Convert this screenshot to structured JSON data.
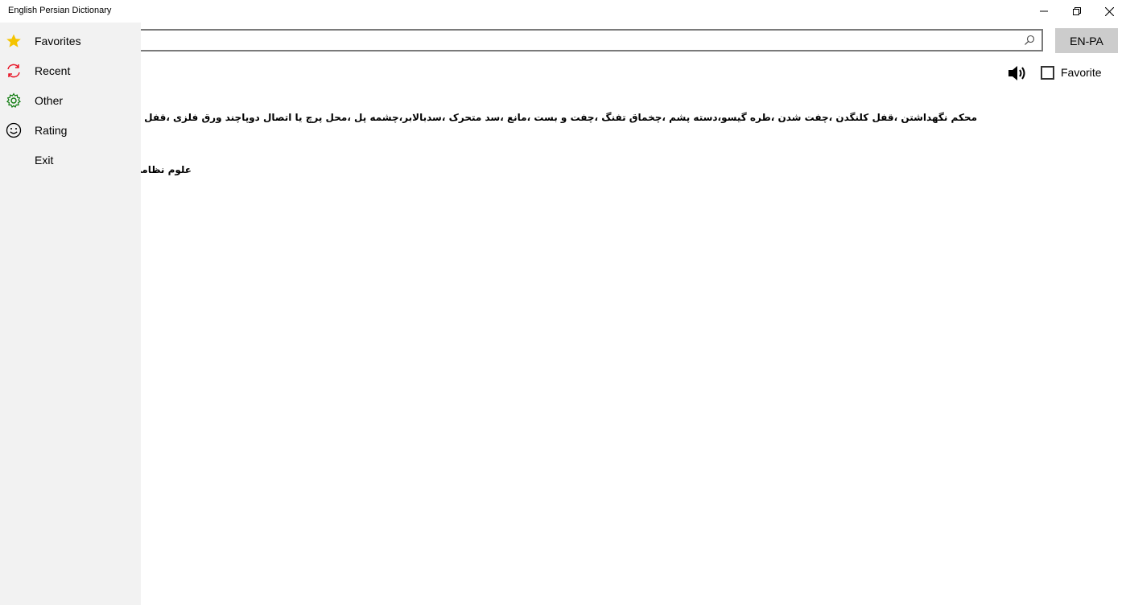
{
  "app": {
    "title": "English Persian Dictionary"
  },
  "window_controls": {
    "minimize": "minimize-icon",
    "maximize": "restore-icon",
    "close": "close-icon"
  },
  "search": {
    "value": "",
    "placeholder": "",
    "icon": "search-icon"
  },
  "language_button": {
    "label": "EN-PA"
  },
  "favorite": {
    "label": "Favorite",
    "checked": false
  },
  "definition": {
    "text": "محکم نگهداشتن ،قفل کلنگدن ،چفت شدن ،طره گیسو،دسته پشم ،چخماق تفنگ ،چفت و بست ،مانع ،سد متحرک ،سدبالابر،چشمه پل ،محل پرچ یا اتصال دوپاچند ورق فلزی ،قفل کردن ،بغل گرفتن ،راکد گذاردن ،قفل شدن ،بوسیله قفل",
    "category": "علوم نظامی :"
  },
  "sidebar": {
    "items": [
      {
        "label": "Favorites",
        "icon": "star-icon",
        "color": "#f5c400"
      },
      {
        "label": "Recent",
        "icon": "refresh-icon",
        "color": "#e81123"
      },
      {
        "label": "Other",
        "icon": "gear-icon",
        "color": "#107c10"
      },
      {
        "label": "Rating",
        "icon": "smiley-icon",
        "color": "#000000"
      },
      {
        "label": "Exit",
        "icon": "",
        "color": ""
      }
    ]
  },
  "colors": {
    "sidebar_bg": "#f2f2f2",
    "lang_button_bg": "#cccccc"
  }
}
